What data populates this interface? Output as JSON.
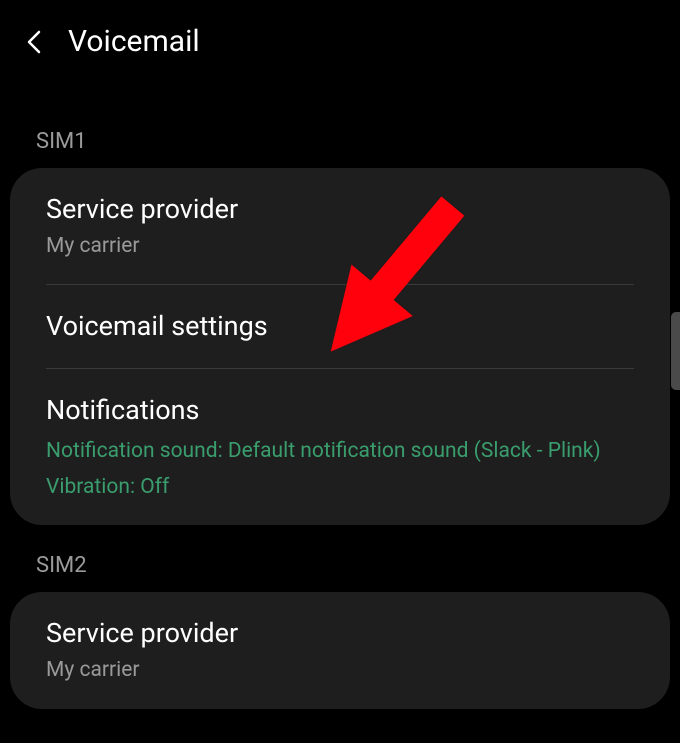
{
  "header": {
    "title": "Voicemail"
  },
  "sim1": {
    "label": "SIM1",
    "service_provider": {
      "title": "Service provider",
      "subtitle": "My carrier"
    },
    "voicemail_settings": {
      "title": "Voicemail settings"
    },
    "notifications": {
      "title": "Notifications",
      "line1": "Notification sound: Default notification sound (Slack - Plink)",
      "line2": "Vibration: Off"
    }
  },
  "sim2": {
    "label": "SIM2",
    "service_provider": {
      "title": "Service provider",
      "subtitle": "My carrier"
    }
  }
}
